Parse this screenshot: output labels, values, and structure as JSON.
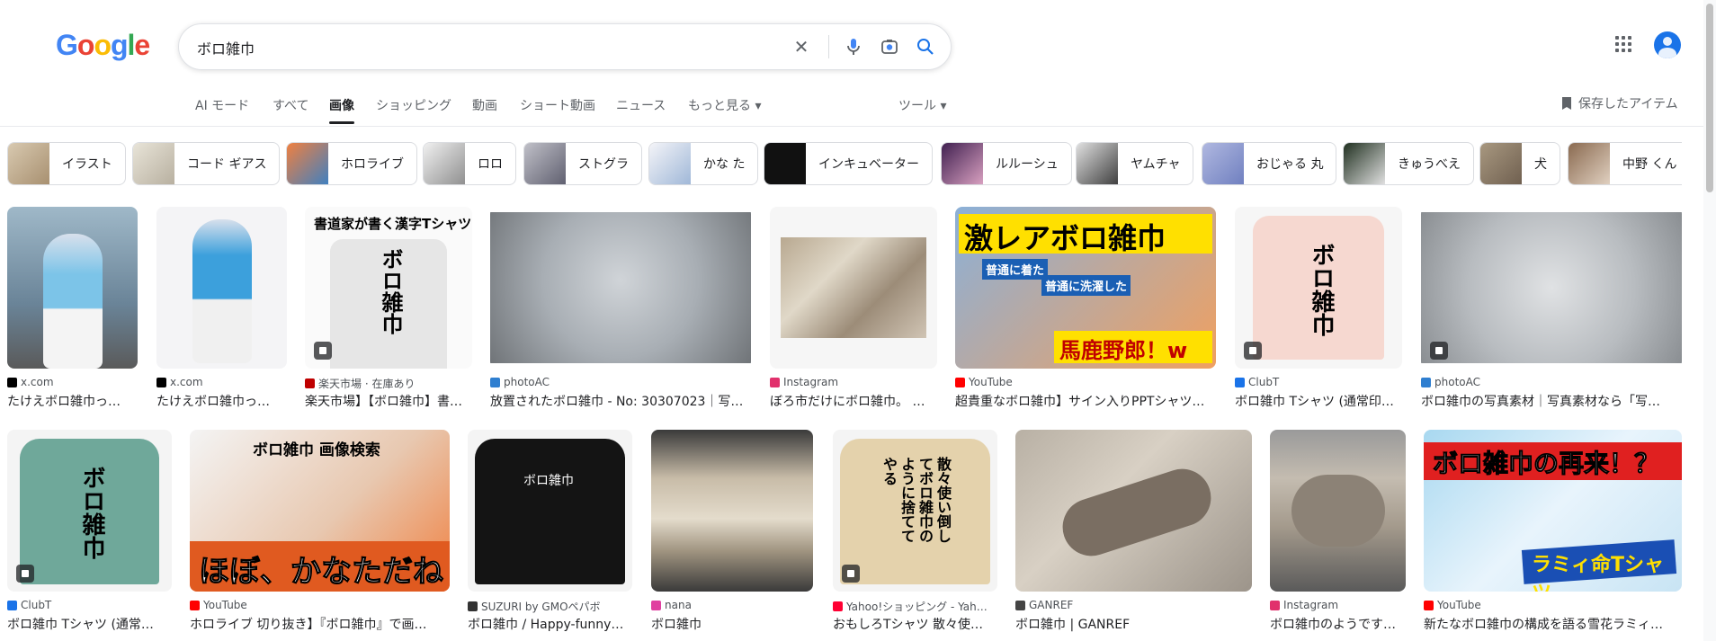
{
  "search": {
    "query": "ボロ雑巾"
  },
  "tabs": [
    "AI モード",
    "すべて",
    "画像",
    "ショッピング",
    "動画",
    "ショート動画",
    "ニュース",
    "もっと見る ▾"
  ],
  "tools": "ツール ▾",
  "saved": "保存したアイテム",
  "chips": [
    "イラスト",
    "コード ギアス",
    "ホロライブ",
    "ロロ",
    "ストグラ",
    "かな た",
    "インキュベーター",
    "ルルーシュ",
    "ヤムチャ",
    "おじゃる 丸",
    "きゅうべえ",
    "犬",
    "中野 くん"
  ],
  "results_row1": [
    {
      "source": "x.com",
      "title": "たけえボロ雑巾っ…"
    },
    {
      "source": "x.com",
      "title": "たけえボロ雑巾っ…"
    },
    {
      "source": "楽天市場 · 在庫あり",
      "title": "楽天市場】【ボロ雑巾】書…"
    },
    {
      "source": "photoAC",
      "title": "放置されたボロ雑巾 - No: 30307023｜写…"
    },
    {
      "source": "Instagram",
      "title": "ぼろ市だけにボロ雑巾。 …"
    },
    {
      "source": "YouTube",
      "title": "超貴重なボロ雑巾】サイン入りPPTシャツ…"
    },
    {
      "source": "ClubT",
      "title": "ボロ雑巾 Tシャツ (通常印…"
    },
    {
      "source": "photoAC",
      "title": "ボロ雑巾の写真素材｜写真素材なら「写…"
    }
  ],
  "results_row2": [
    {
      "source": "ClubT",
      "title": "ボロ雑巾 Tシャツ (通常…"
    },
    {
      "source": "YouTube",
      "title": "ホロライブ 切り抜き】『ボロ雑巾』で画…"
    },
    {
      "source": "SUZURI by GMOペパボ",
      "title": "ボロ雑巾 / Happy-funny…"
    },
    {
      "source": "nana",
      "title": "ボロ雑巾"
    },
    {
      "source": "Yahoo!ショッピング - Yah…",
      "title": "おもしろTシャツ 散々使…"
    },
    {
      "source": "GANREF",
      "title": "ボロ雑巾 | GANREF"
    },
    {
      "source": "Instagram",
      "title": "ボロ雑巾のようです…"
    },
    {
      "source": "YouTube",
      "title": "新たなボロ雑巾の構成を語る雪花ラミィ…"
    }
  ],
  "overlays": {
    "kanji_shirt": "ボロ雑巾",
    "shodo_header": "書道家が書く漢字Tシャツ",
    "rare_title": "激レアボロ雑巾",
    "rare_sub1": "普通に着た",
    "rare_sub2": "普通に洗濯した",
    "rare_bottom": "馬鹿野郎！w",
    "search_title": "ボロ雑巾 画像検索",
    "hohoh": "ほぼ、かなただね",
    "black_shirt": "ボロ雑巾",
    "saisan": "散々使い倒してボロ雑巾のように捨ててやる",
    "again": "ボロ雑巾の再来！？",
    "lamy": "ラミィ命Tシャツ"
  },
  "colors": {
    "accent": "#1a73e8",
    "youtube": "#ff0000",
    "instagram": "#e1306c",
    "rakuten": "#bf0000"
  }
}
